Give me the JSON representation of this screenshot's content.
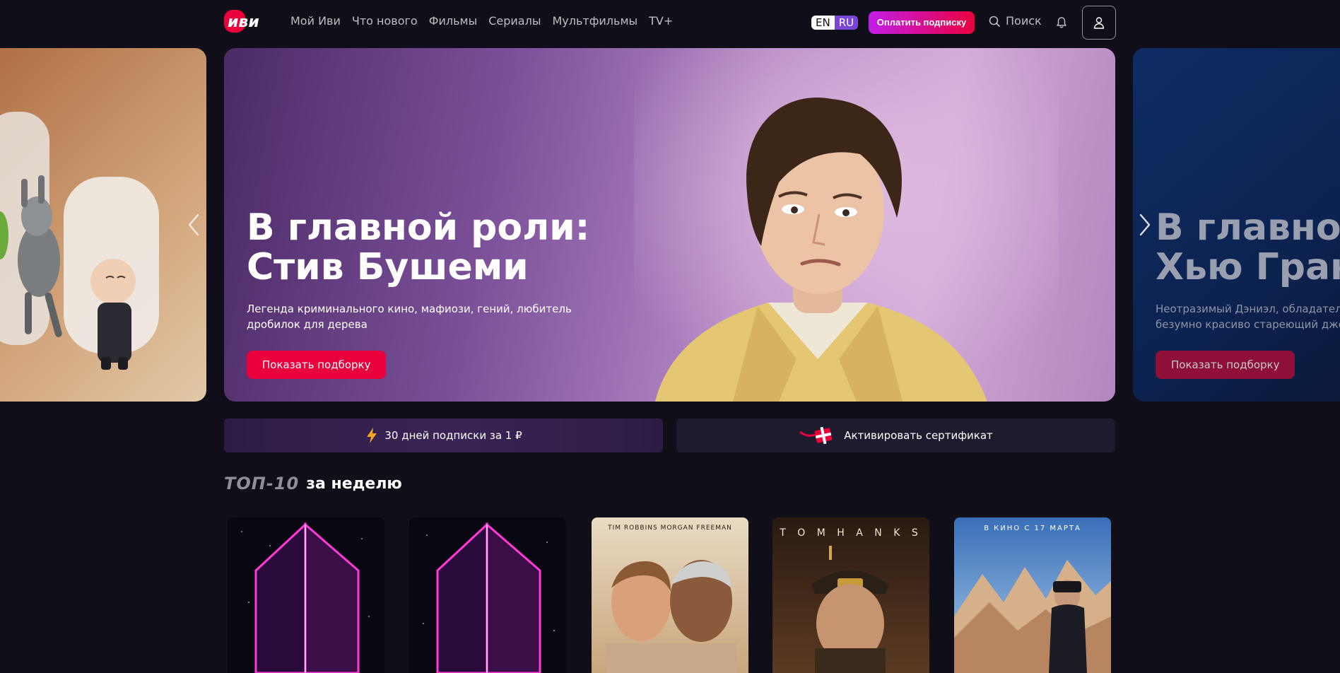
{
  "header": {
    "logo_text": "иви",
    "nav": [
      "Мой Иви",
      "Что нового",
      "Фильмы",
      "Сериалы",
      "Мультфильмы",
      "TV+"
    ],
    "lang_en": "EN",
    "lang_ru": "RU",
    "pay_button": "Оплатить подписку",
    "search_label": "Поиск"
  },
  "carousel": {
    "main": {
      "title_line1": "В главной роли:",
      "title_line2": "Стив Бушеми",
      "description": "Легенда криминального кино, мафиози, гений, любитель дробилок для дерева",
      "button": "Показать подборку"
    },
    "next": {
      "title_line1": "В главной",
      "title_line2": "Хью Гран",
      "desc_line1": "Неотразимый Дэниэл, обладатель н",
      "desc_line2": "безумно красиво стареющий джент",
      "button": "Показать подборку"
    }
  },
  "promos": {
    "subscription": "30 дней подписки за 1 ₽",
    "certificate": "Активировать сертификат"
  },
  "top10": {
    "badge": "ТОП-10",
    "label": "за неделю",
    "posters": [
      {
        "top_text": ""
      },
      {
        "top_text": ""
      },
      {
        "top_text": "TIM ROBBINS    MORGAN FREEMAN"
      },
      {
        "top_text": "T O M    H A N K S"
      },
      {
        "top_text": "В КИНО С 17 МАРТА"
      }
    ]
  },
  "colors": {
    "background": "#100e19",
    "accent_red": "#ea003d",
    "accent_purple": "#c21ee9",
    "lang_ru": "#7b46d6"
  }
}
